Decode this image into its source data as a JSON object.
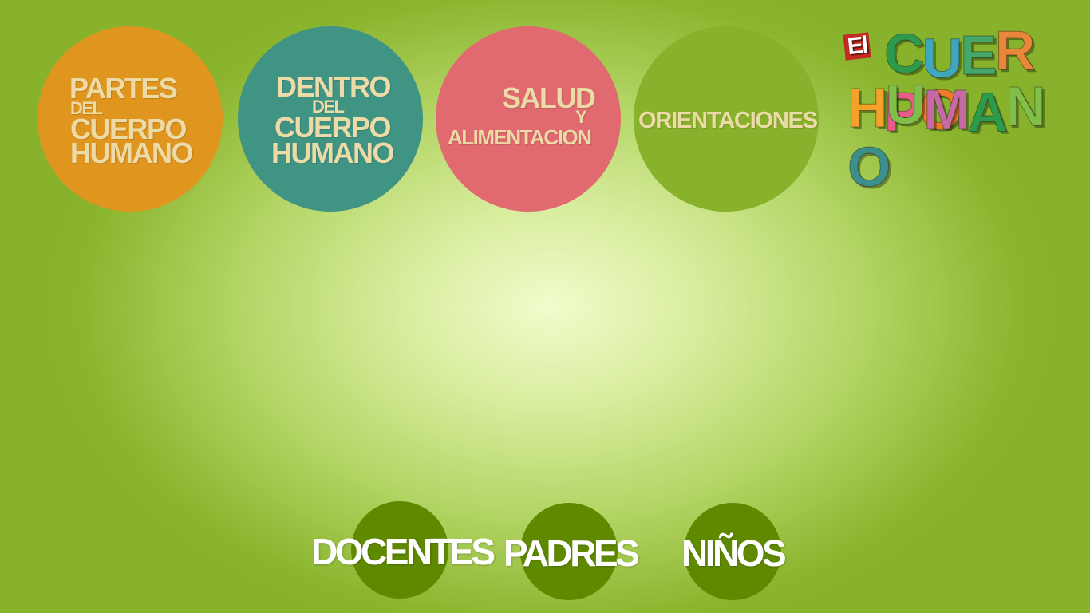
{
  "menu": {
    "partes": {
      "line1": "PARTES",
      "line2": "DEL",
      "line3": "CUERPO",
      "line4": "HUMANO"
    },
    "dentro": {
      "line1": "DENTRO",
      "line2": "DEL",
      "line3": "CUERPO",
      "line4": "HUMANO"
    },
    "salud": {
      "line1": "SALUD",
      "line2": "Y",
      "line3": "ALIMENTACION"
    },
    "orientaciones": {
      "label": "ORIENTACIONES"
    }
  },
  "logo": {
    "el": "El",
    "letters_row1": [
      "C",
      "U",
      "E",
      "R",
      "P",
      "O"
    ],
    "letters_row2": [
      "H",
      "U",
      "M",
      "A",
      "N",
      "O"
    ],
    "colors_row1": [
      "#2e9a4e",
      "#3fa7bd",
      "#45a86a",
      "#e8863a",
      "#e95b8a",
      "#f07a2c"
    ],
    "colors_row2": [
      "#f3a128",
      "#7fbf4a",
      "#c66aa6",
      "#2e9a4e",
      "#7fbf4a",
      "#3c8f8a"
    ]
  },
  "audience": {
    "docentes": "DOCENTES",
    "padres": "PADRES",
    "ninos": "NIÑOS"
  },
  "colors": {
    "orange": "#e0951f",
    "teal": "#409484",
    "pink": "#e06a6f",
    "green": "#88b22c",
    "dark_green": "#5f8a00",
    "menu_text": "#ecdba6"
  }
}
